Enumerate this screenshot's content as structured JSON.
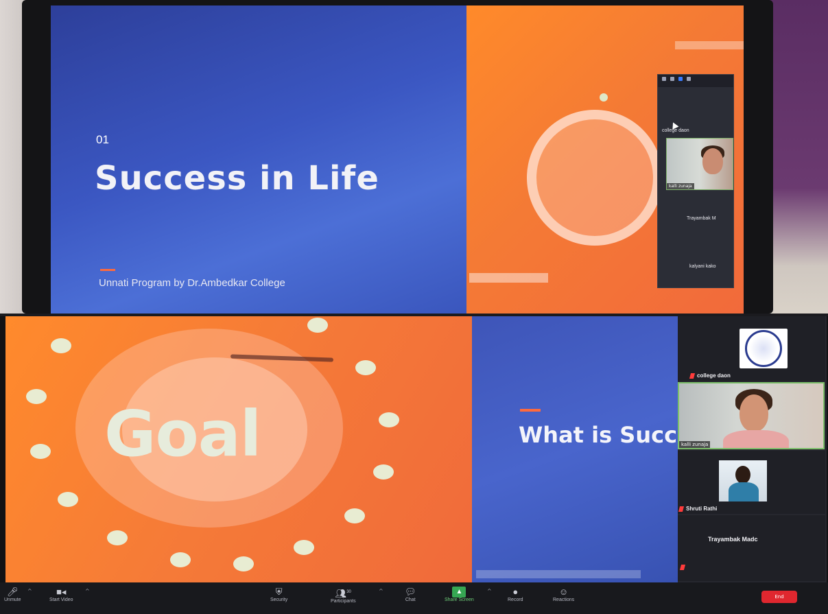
{
  "top_slide": {
    "number": "01",
    "title": "Success in Life",
    "subtitle": "Unnati Program by Dr.Ambedkar College"
  },
  "top_zoom_panel": {
    "participants": [
      {
        "name": "college daon"
      },
      {
        "name": "kalli zunaja"
      },
      {
        "name": "Trayambak M"
      },
      {
        "name": "kalyani kako"
      }
    ]
  },
  "bottom_slide_left": {
    "text": "Goal"
  },
  "bottom_slide_right": {
    "title": "What is Success"
  },
  "gallery": {
    "tiles": [
      {
        "name": "college daon"
      },
      {
        "name": "kalli zunaja"
      },
      {
        "name": "Shruti Rathi"
      },
      {
        "name": "Trayambak Madc"
      }
    ]
  },
  "toolbar": {
    "unmute": "Unmute",
    "start_video": "Start Video",
    "security": "Security",
    "participants": "Participants",
    "participants_count": "30",
    "chat": "Chat",
    "share_screen": "Share Screen",
    "record": "Record",
    "reactions": "Reactions",
    "end": "End"
  },
  "colors": {
    "slide_blue": "#3b57c2",
    "slide_orange": "#f47a35",
    "accent": "#ff6a3d",
    "end_red": "#e0272f",
    "share_green": "#36a853"
  },
  "icons": {
    "mic": "mic-icon",
    "video": "video-camera-icon",
    "security": "shield-icon",
    "participants": "people-icon",
    "chat": "chat-bubble-icon",
    "share": "share-screen-icon",
    "record": "record-icon",
    "reactions": "smiley-icon"
  }
}
